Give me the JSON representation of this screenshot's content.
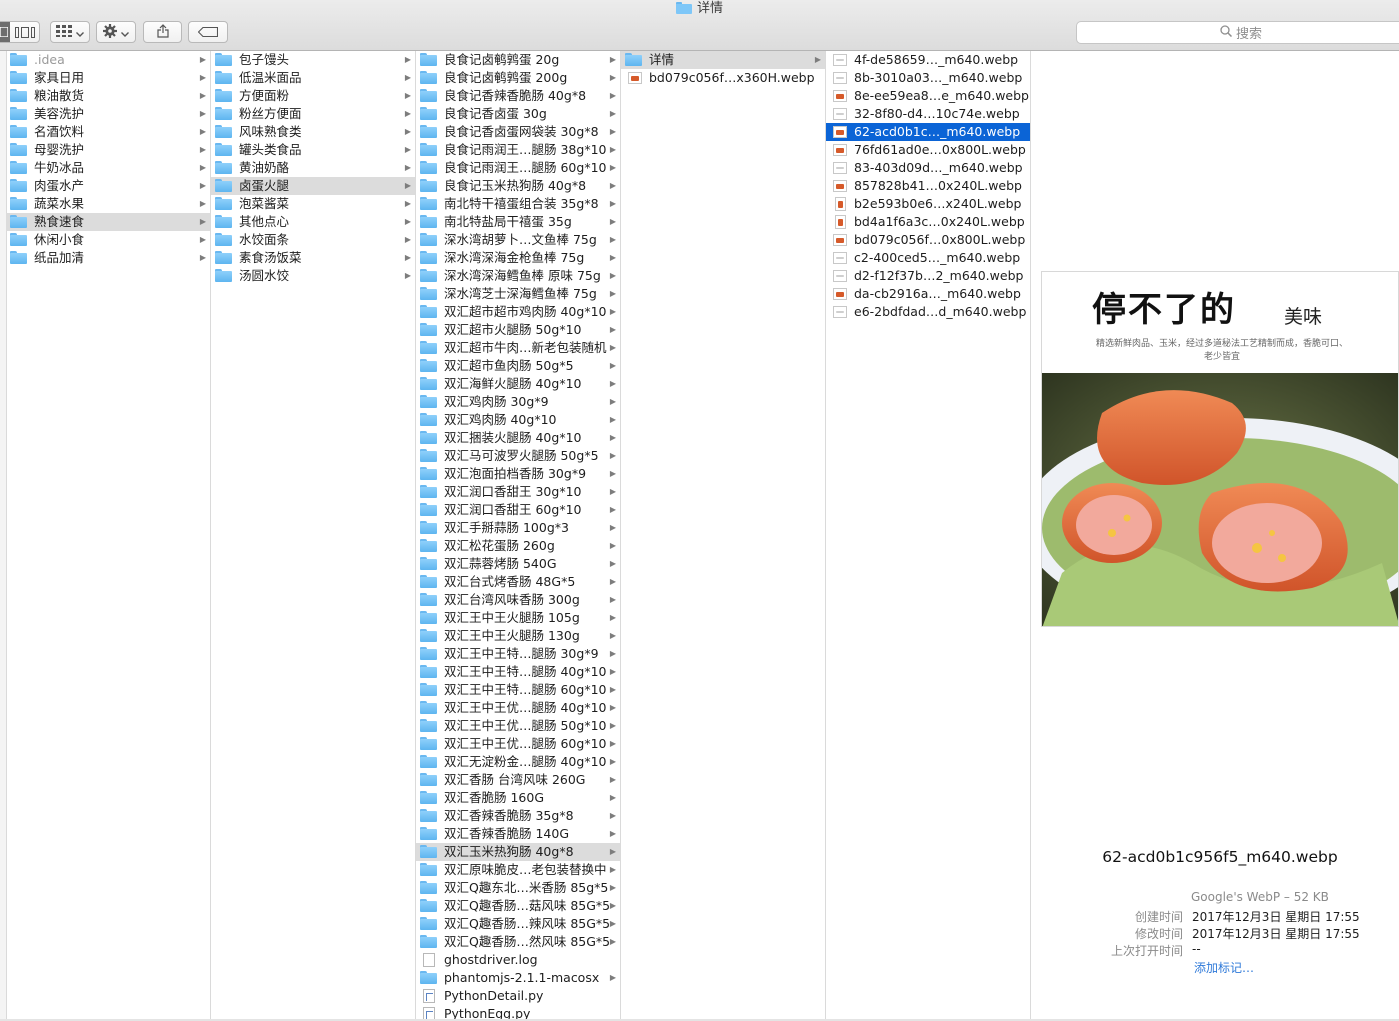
{
  "window": {
    "title": "详情"
  },
  "toolbar": {
    "search_placeholder": "搜索"
  },
  "columns": [
    {
      "items": [
        {
          "label": ".idea",
          "type": "folder",
          "arrow": true,
          "dim": true
        },
        {
          "label": "家具日用",
          "type": "folder",
          "arrow": true
        },
        {
          "label": "粮油散货",
          "type": "folder",
          "arrow": true
        },
        {
          "label": "美容洗护",
          "type": "folder",
          "arrow": true
        },
        {
          "label": "名酒饮料",
          "type": "folder",
          "arrow": true
        },
        {
          "label": "母婴洗护",
          "type": "folder",
          "arrow": true
        },
        {
          "label": "牛奶冰品",
          "type": "folder",
          "arrow": true
        },
        {
          "label": "肉蛋水产",
          "type": "folder",
          "arrow": true
        },
        {
          "label": "蔬菜水果",
          "type": "folder",
          "arrow": true
        },
        {
          "label": "熟食速食",
          "type": "folder",
          "arrow": true,
          "selected": "gray"
        },
        {
          "label": "休闲小食",
          "type": "folder",
          "arrow": true
        },
        {
          "label": "纸品加清",
          "type": "folder",
          "arrow": true
        }
      ]
    },
    {
      "items": [
        {
          "label": "包子馒头",
          "type": "folder",
          "arrow": true
        },
        {
          "label": "低温米面品",
          "type": "folder",
          "arrow": true
        },
        {
          "label": "方便面粉",
          "type": "folder",
          "arrow": true
        },
        {
          "label": "粉丝方便面",
          "type": "folder",
          "arrow": true
        },
        {
          "label": "风味熟食类",
          "type": "folder",
          "arrow": true
        },
        {
          "label": "罐头类食品",
          "type": "folder",
          "arrow": true
        },
        {
          "label": "黄油奶酪",
          "type": "folder",
          "arrow": true
        },
        {
          "label": "卤蛋火腿",
          "type": "folder",
          "arrow": true,
          "selected": "gray"
        },
        {
          "label": "泡菜酱菜",
          "type": "folder",
          "arrow": true
        },
        {
          "label": "其他点心",
          "type": "folder",
          "arrow": true
        },
        {
          "label": "水饺面条",
          "type": "folder",
          "arrow": true
        },
        {
          "label": "素食汤饭菜",
          "type": "folder",
          "arrow": true
        },
        {
          "label": "汤圆水饺",
          "type": "folder",
          "arrow": true
        }
      ]
    },
    {
      "items": [
        {
          "label": "良食记卤鹌鹑蛋 20g",
          "type": "folder",
          "arrow": true
        },
        {
          "label": "良食记卤鹌鹑蛋 200g",
          "type": "folder",
          "arrow": true
        },
        {
          "label": "良食记香辣香脆肠 40g*8",
          "type": "folder",
          "arrow": true
        },
        {
          "label": "良食记香卤蛋 30g",
          "type": "folder",
          "arrow": true
        },
        {
          "label": "良食记香卤蛋网袋装 30g*8",
          "type": "folder",
          "arrow": true
        },
        {
          "label": "良食记雨润王…腿肠 38g*10",
          "type": "folder",
          "arrow": true
        },
        {
          "label": "良食记雨润王…腿肠 60g*10",
          "type": "folder",
          "arrow": true
        },
        {
          "label": "良食记玉米热狗肠 40g*8",
          "type": "folder",
          "arrow": true
        },
        {
          "label": "南北特干禧蛋组合装 35g*8",
          "type": "folder",
          "arrow": true
        },
        {
          "label": "南北特盐局干禧蛋 35g",
          "type": "folder",
          "arrow": true
        },
        {
          "label": "深水湾胡萝卜…文鱼棒 75g",
          "type": "folder",
          "arrow": true
        },
        {
          "label": "深水湾深海金枪鱼棒 75g",
          "type": "folder",
          "arrow": true
        },
        {
          "label": "深水湾深海鳕鱼棒 原味 75g",
          "type": "folder",
          "arrow": true
        },
        {
          "label": "深水湾芝士深海鳕鱼棒 75g",
          "type": "folder",
          "arrow": true
        },
        {
          "label": "双汇超市超市鸡肉肠 40g*10",
          "type": "folder",
          "arrow": true
        },
        {
          "label": "双汇超市火腿肠 50g*10",
          "type": "folder",
          "arrow": true
        },
        {
          "label": "双汇超市牛肉…新老包装随机",
          "type": "folder",
          "arrow": true
        },
        {
          "label": "双汇超市鱼肉肠 50g*5",
          "type": "folder",
          "arrow": true
        },
        {
          "label": "双汇海鲜火腿肠 40g*10",
          "type": "folder",
          "arrow": true
        },
        {
          "label": "双汇鸡肉肠 30g*9",
          "type": "folder",
          "arrow": true
        },
        {
          "label": "双汇鸡肉肠 40g*10",
          "type": "folder",
          "arrow": true
        },
        {
          "label": "双汇捆装火腿肠 40g*10",
          "type": "folder",
          "arrow": true
        },
        {
          "label": "双汇马可波罗火腿肠 50g*5",
          "type": "folder",
          "arrow": true
        },
        {
          "label": "双汇泡面拍档香肠 30g*9",
          "type": "folder",
          "arrow": true
        },
        {
          "label": "双汇润口香甜王 30g*10",
          "type": "folder",
          "arrow": true
        },
        {
          "label": "双汇润口香甜王 60g*10",
          "type": "folder",
          "arrow": true
        },
        {
          "label": "双汇手掰蒜肠 100g*3",
          "type": "folder",
          "arrow": true
        },
        {
          "label": "双汇松花蛋肠 260g",
          "type": "folder",
          "arrow": true
        },
        {
          "label": "双汇蒜蓉烤肠 540G",
          "type": "folder",
          "arrow": true
        },
        {
          "label": "双汇台式烤香肠 48G*5",
          "type": "folder",
          "arrow": true
        },
        {
          "label": "双汇台湾风味香肠 300g",
          "type": "folder",
          "arrow": true
        },
        {
          "label": "双汇王中王火腿肠 105g",
          "type": "folder",
          "arrow": true
        },
        {
          "label": "双汇王中王火腿肠 130g",
          "type": "folder",
          "arrow": true
        },
        {
          "label": "双汇王中王特…腿肠 30g*9",
          "type": "folder",
          "arrow": true
        },
        {
          "label": "双汇王中王特…腿肠 40g*10",
          "type": "folder",
          "arrow": true
        },
        {
          "label": "双汇王中王特…腿肠 60g*10",
          "type": "folder",
          "arrow": true
        },
        {
          "label": "双汇王中王优…腿肠 40g*10",
          "type": "folder",
          "arrow": true
        },
        {
          "label": "双汇王中王优…腿肠 50g*10",
          "type": "folder",
          "arrow": true
        },
        {
          "label": "双汇王中王优…腿肠 60g*10",
          "type": "folder",
          "arrow": true
        },
        {
          "label": "双汇无淀粉金…腿肠 40g*10",
          "type": "folder",
          "arrow": true
        },
        {
          "label": "双汇香肠 台湾风味 260G",
          "type": "folder",
          "arrow": true
        },
        {
          "label": "双汇香脆肠 160G",
          "type": "folder",
          "arrow": true
        },
        {
          "label": "双汇香辣香脆肠 35g*8",
          "type": "folder",
          "arrow": true
        },
        {
          "label": "双汇香辣香脆肠 140G",
          "type": "folder",
          "arrow": true
        },
        {
          "label": "双汇玉米热狗肠 40g*8",
          "type": "folder",
          "arrow": true,
          "selected": "gray"
        },
        {
          "label": "双汇原味脆皮…老包装替换中",
          "type": "folder",
          "arrow": true
        },
        {
          "label": "双汇Q趣东北…米香肠 85g*5",
          "type": "folder",
          "arrow": true
        },
        {
          "label": "双汇Q趣香肠…菇风味 85G*5",
          "type": "folder",
          "arrow": true
        },
        {
          "label": "双汇Q趣香肠…辣风味 85G*5",
          "type": "folder",
          "arrow": true
        },
        {
          "label": "双汇Q趣香肠…然风味 85G*5",
          "type": "folder",
          "arrow": true
        },
        {
          "label": "ghostdriver.log",
          "type": "file",
          "arrow": false
        },
        {
          "label": "phantomjs-2.1.1-macosx",
          "type": "folder",
          "arrow": true
        },
        {
          "label": "PythonDetail.py",
          "type": "py",
          "arrow": false
        },
        {
          "label": "PythonEgg.py",
          "type": "py",
          "arrow": false
        }
      ]
    },
    {
      "items": [
        {
          "label": "详情",
          "type": "folder",
          "arrow": true,
          "selected": "gray"
        },
        {
          "label": "bd079c056f…x360H.webp",
          "type": "image",
          "arrow": false
        }
      ]
    },
    {
      "items": [
        {
          "label": "4f-de58659…_m640.webp",
          "type": "image-pale",
          "arrow": false
        },
        {
          "label": "8b-3010a03…_m640.webp",
          "type": "image-pale",
          "arrow": false
        },
        {
          "label": "8e-ee59ea8…e_m640.webp",
          "type": "image",
          "arrow": false
        },
        {
          "label": "32-8f80-d4…10c74e.webp",
          "type": "image-pale",
          "arrow": false
        },
        {
          "label": "62-acd0b1c…_m640.webp",
          "type": "image",
          "arrow": false,
          "selected": "blue"
        },
        {
          "label": "76fd61ad0e…0x800L.webp",
          "type": "image",
          "arrow": false
        },
        {
          "label": "83-403d09d…_m640.webp",
          "type": "image-pale",
          "arrow": false
        },
        {
          "label": "857828b41…0x240L.webp",
          "type": "image",
          "arrow": false
        },
        {
          "label": "b2e593b0e6…x240L.webp",
          "type": "image-tall",
          "arrow": false
        },
        {
          "label": "bd4a1f6a3c…0x240L.webp",
          "type": "image-tall",
          "arrow": false
        },
        {
          "label": "bd079c056f…0x800L.webp",
          "type": "image",
          "arrow": false
        },
        {
          "label": "c2-400ced5…_m640.webp",
          "type": "image-pale",
          "arrow": false
        },
        {
          "label": "d2-f12f37b…2_m640.webp",
          "type": "image-pale",
          "arrow": false
        },
        {
          "label": "da-cb2916a…_m640.webp",
          "type": "image",
          "arrow": false
        },
        {
          "label": "e6-2bdfdad…d_m640.webp",
          "type": "image-pale",
          "arrow": false
        }
      ]
    }
  ],
  "preview": {
    "slogan_big": "停不了的",
    "slogan_small": "美味",
    "slogan_desc": "精选新鲜肉品、玉米，经过多道秘法工艺精制而成，香脆可口、老少皆宜",
    "filename": "62-acd0b1c956f5_m640.webp",
    "kind": "Google's WebP – 52 KB",
    "meta": [
      {
        "key": "创建时间",
        "value": "2017年12月3日 星期日 17:55"
      },
      {
        "key": "修改时间",
        "value": "2017年12月3日 星期日 17:55"
      },
      {
        "key": "上次打开时间",
        "value": "--"
      }
    ],
    "add_tags": "添加标记…"
  },
  "colors": {
    "selection_blue": "#0b64d6",
    "selection_gray": "#dcdcdc",
    "folder_blue": "#6ab8f0",
    "link_blue": "#2f7ad9"
  },
  "icons": {
    "toolbar": [
      "sidebar-icon",
      "column-view-icon",
      "grid-icon",
      "gear-icon",
      "share-icon",
      "tag-icon",
      "search-icon"
    ]
  }
}
